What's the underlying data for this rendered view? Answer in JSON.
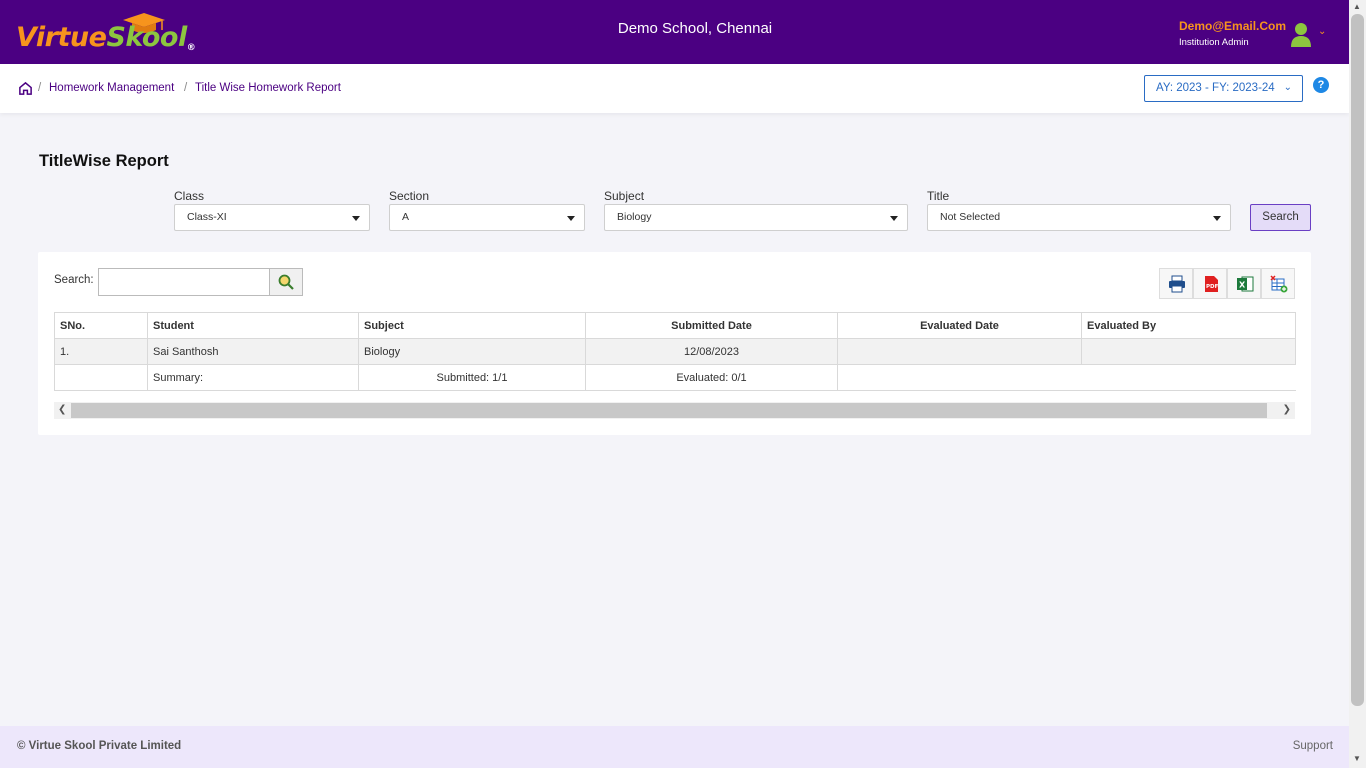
{
  "header": {
    "logo_main": "Virtue",
    "logo_accent": "Skool",
    "logo_reg": "®",
    "school": "Demo School, Chennai",
    "user_email": "Demo@Email.Com",
    "user_role": "Institution Admin",
    "colors": {
      "bg": "#4b0082",
      "orange": "#f7941d",
      "green": "#8dc63f"
    }
  },
  "breadcrumb": {
    "items": [
      "Homework Management",
      "Title Wise Homework Report"
    ],
    "separator": "/",
    "ay_label": "AY: 2023 - FY: 2023-24"
  },
  "page": {
    "title": "TitleWise Report"
  },
  "filters": {
    "class": {
      "label": "Class",
      "value": "Class-XI"
    },
    "section": {
      "label": "Section",
      "value": "A"
    },
    "subject": {
      "label": "Subject",
      "value": "Biology"
    },
    "title": {
      "label": "Title",
      "value": "Not Selected"
    },
    "search_button": "Search"
  },
  "report": {
    "search_label": "Search:",
    "search_value": "",
    "columns": [
      "SNo.",
      "Student",
      "Subject",
      "Submitted Date",
      "Evaluated Date",
      "Evaluated By"
    ],
    "rows": [
      {
        "sno": "1.",
        "student": "Sai Santhosh",
        "subject": "Biology",
        "submitted": "12/08/2023",
        "evaluated": "",
        "evaluated_by": ""
      }
    ],
    "summary": {
      "label": "Summary:",
      "submitted": "Submitted: 1/1",
      "evaluated": "Evaluated: 0/1"
    }
  },
  "footer": {
    "copyright": "© Virtue Skool Private Limited",
    "support": "Support"
  }
}
